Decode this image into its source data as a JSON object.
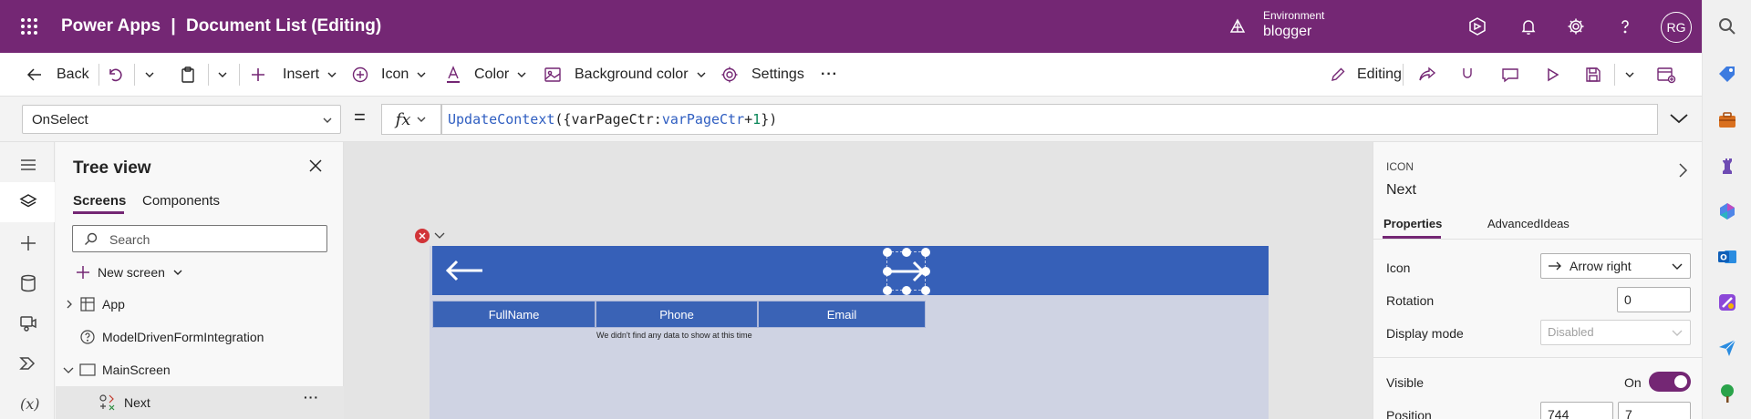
{
  "header": {
    "app_name": "Power Apps",
    "separator": "|",
    "doc_title": "Document List (Editing)",
    "environment_label": "Environment",
    "environment_name": "blogger",
    "avatar_initials": "RG"
  },
  "commandbar": {
    "back": "Back",
    "insert": "Insert",
    "icon": "Icon",
    "color": "Color",
    "background_color": "Background color",
    "settings": "Settings",
    "more": "···",
    "editing": "Editing"
  },
  "formulabar": {
    "property": "OnSelect",
    "equals": "=",
    "fx": "fx",
    "formula_func": "UpdateContext",
    "formula_p1": "({varPageCtr:",
    "formula_var": "varPageCtr",
    "formula_op": "+",
    "formula_num": "1",
    "formula_end": "})"
  },
  "treeview": {
    "title": "Tree view",
    "tabs": [
      "Screens",
      "Components"
    ],
    "search_placeholder": "Search",
    "new_screen": "New screen",
    "items": [
      {
        "label": "App"
      },
      {
        "label": "ModelDrivenFormIntegration"
      },
      {
        "label": "MainScreen"
      },
      {
        "label": "Next"
      }
    ],
    "more": "···"
  },
  "canvas": {
    "columns": [
      "FullName",
      "Phone",
      "Email"
    ],
    "empty_message": "We didn't find any data to show at this time"
  },
  "properties": {
    "type_label": "ICON",
    "control_name": "Next",
    "tabs": [
      "Properties",
      "Advanced",
      "Ideas"
    ],
    "icon_label": "Icon",
    "icon_value": "Arrow right",
    "rotation_label": "Rotation",
    "rotation_value": "0",
    "display_mode_label": "Display mode",
    "display_mode_value": "Disabled",
    "visible_label": "Visible",
    "visible_value": "On",
    "position_label": "Position",
    "position_x": "744",
    "position_y": "7"
  },
  "colors": {
    "brand": "#742774",
    "app_bar": "#3660b8",
    "screen_bg": "#cfd3e3",
    "error": "#d13438"
  }
}
